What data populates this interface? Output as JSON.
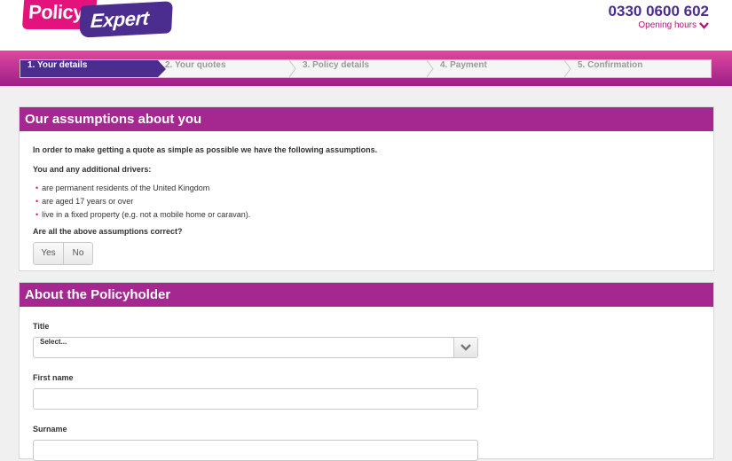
{
  "logo": {
    "part1": "Policy",
    "part2": "Expert"
  },
  "header": {
    "phone": "0330 0600 602",
    "opening_hours": "Opening hours"
  },
  "steps": [
    {
      "label": "1. Your details",
      "active": true
    },
    {
      "label": "2. Your quotes",
      "active": false
    },
    {
      "label": "3. Policy details",
      "active": false
    },
    {
      "label": "4. Payment",
      "active": false
    },
    {
      "label": "5. Confirmation",
      "active": false
    }
  ],
  "assumptions": {
    "title": "Our assumptions about you",
    "intro": "In order to make getting a quote as simple as possible we have the following assumptions.",
    "drivers_heading": "You and any additional drivers:",
    "items": [
      "are permanent residents of the United Kingdom",
      "are aged 17 years or over",
      "live in a fixed property (e.g. not a mobile home or caravan)."
    ],
    "question": "Are all the above assumptions correct?",
    "yes_label": "Yes",
    "no_label": "No"
  },
  "policyholder": {
    "title": "About the Policyholder",
    "title_label": "Title",
    "title_select_value": "Select...",
    "first_name_label": "First name",
    "first_name_value": "",
    "surname_label": "Surname",
    "surname_value": ""
  },
  "colors": {
    "brand_purple": "#4b2d8f",
    "brand_pink": "#e4127d",
    "panel_header": "#a4288f"
  },
  "icons": {
    "dropdown": "chevron-down-icon",
    "opening": "chevron-down-icon"
  }
}
